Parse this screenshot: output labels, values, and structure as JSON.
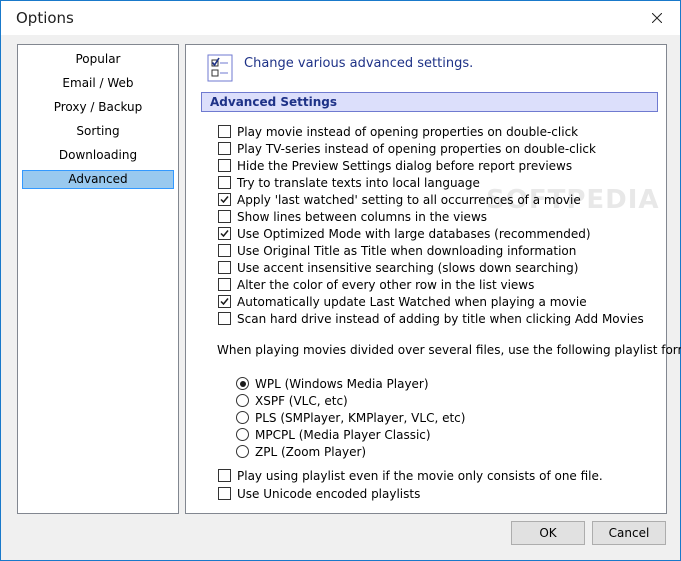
{
  "window": {
    "title": "Options"
  },
  "sidebar": {
    "items": [
      {
        "label": "Popular",
        "selected": false
      },
      {
        "label": "Email / Web",
        "selected": false
      },
      {
        "label": "Proxy / Backup",
        "selected": false
      },
      {
        "label": "Sorting",
        "selected": false
      },
      {
        "label": "Downloading",
        "selected": false
      },
      {
        "label": "Advanced",
        "selected": true
      }
    ]
  },
  "content": {
    "header_icon": "checklist-icon",
    "header_text": "Change various advanced settings.",
    "section_title": "Advanced Settings",
    "watermark": "SOFTPEDIA",
    "options": [
      {
        "label": "Play movie instead of opening properties on double-click",
        "checked": false
      },
      {
        "label": "Play TV-series instead of opening properties on double-click",
        "checked": false
      },
      {
        "label": "Hide the Preview Settings dialog before report previews",
        "checked": false
      },
      {
        "label": "Try to translate texts into local language",
        "checked": false
      },
      {
        "label": "Apply 'last watched' setting to all occurrences of a movie",
        "checked": true
      },
      {
        "label": "Show lines between columns in the views",
        "checked": false
      },
      {
        "label": "Use Optimized Mode with large databases (recommended)",
        "checked": true
      },
      {
        "label": "Use Original Title as Title when downloading information",
        "checked": false
      },
      {
        "label": "Use accent insensitive searching (slows down searching)",
        "checked": false
      },
      {
        "label": "Alter the color of every other row in the list views",
        "checked": false
      },
      {
        "label": "Automatically update Last Watched when playing a movie",
        "checked": true
      },
      {
        "label": "Scan hard drive instead of adding by title when clicking Add Movies",
        "checked": false
      }
    ],
    "playlist_label": "When playing movies divided over several files, use the following playlist format:",
    "playlist_formats": [
      {
        "label": "WPL (Windows Media Player)",
        "selected": true
      },
      {
        "label": "XSPF (VLC, etc)",
        "selected": false
      },
      {
        "label": "PLS (SMPlayer, KMPlayer, VLC, etc)",
        "selected": false
      },
      {
        "label": "MPCPL (Media Player Classic)",
        "selected": false
      },
      {
        "label": "ZPL (Zoom Player)",
        "selected": false
      }
    ],
    "playlist_options": [
      {
        "label": "Play using playlist even if the movie only consists of one file.",
        "checked": false
      },
      {
        "label": "Use Unicode encoded playlists",
        "checked": false
      }
    ]
  },
  "buttons": {
    "ok": "OK",
    "cancel": "Cancel"
  },
  "colors": {
    "accent": "#1979ca",
    "selection": "#99c9ef",
    "header_text": "#1e3287",
    "section_bg": "#dcdffb"
  }
}
